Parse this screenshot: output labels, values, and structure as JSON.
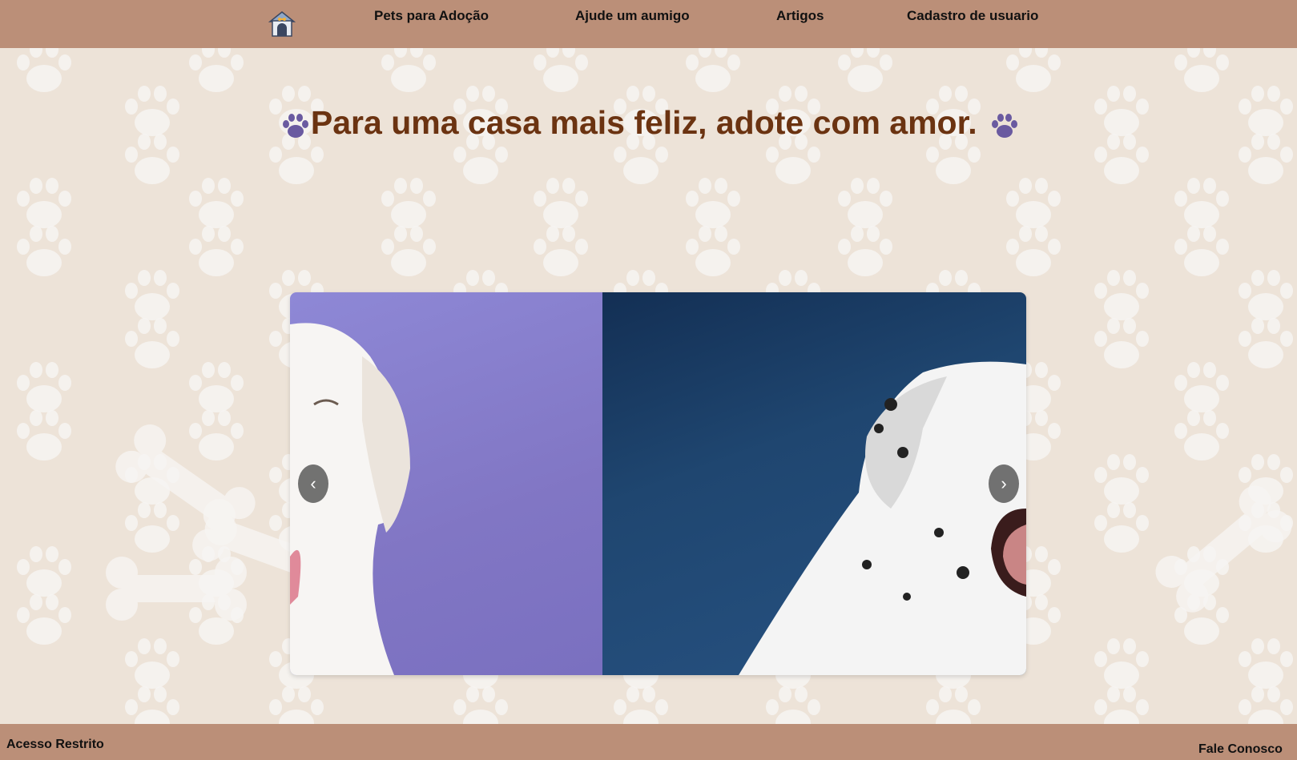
{
  "nav": {
    "logo_icon": "dog-house-icon",
    "links": [
      "Pets para Adoção",
      "Ajude um aumigo",
      "Artigos",
      "Cadastro de usuario"
    ]
  },
  "hero": {
    "title": "Para uma casa mais feliz, adote com amor."
  },
  "carousel": {
    "prev_label": "‹",
    "next_label": "›"
  },
  "footer": {
    "left_link": "Acesso Restrito",
    "right_link": "Fale Conosco"
  },
  "colors": {
    "nav_bg": "#bb8f78",
    "page_bg": "#ede3d8",
    "title": "#6b3311",
    "paw_accent": "#6a5aa0"
  }
}
